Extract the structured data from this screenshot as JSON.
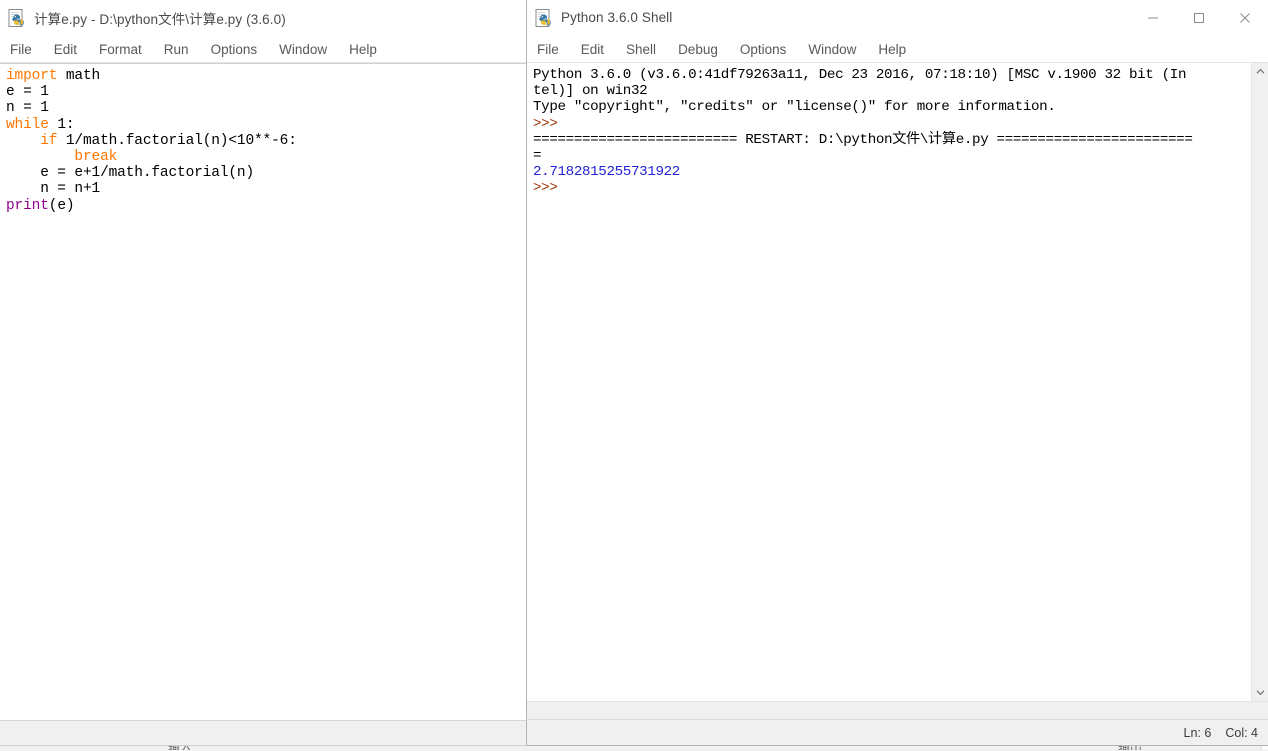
{
  "editor_window": {
    "icon": "python-idle-icon",
    "title": "计算e.py - D:\\python文件\\计算e.py (3.6.0)",
    "menus": [
      "File",
      "Edit",
      "Format",
      "Run",
      "Options",
      "Window",
      "Help"
    ],
    "code_lines": [
      [
        {
          "t": "import",
          "c": "kw"
        },
        {
          "t": " math",
          "c": ""
        }
      ],
      [
        {
          "t": "e = 1",
          "c": ""
        }
      ],
      [
        {
          "t": "n = 1",
          "c": ""
        }
      ],
      [
        {
          "t": "while",
          "c": "kw"
        },
        {
          "t": " 1:",
          "c": ""
        }
      ],
      [
        {
          "t": "    ",
          "c": ""
        },
        {
          "t": "if",
          "c": "kw"
        },
        {
          "t": " 1/math.factorial(n)<10**-6:",
          "c": ""
        }
      ],
      [
        {
          "t": "        ",
          "c": ""
        },
        {
          "t": "break",
          "c": "kw"
        }
      ],
      [
        {
          "t": "    e = e+1/math.factorial(n)",
          "c": ""
        }
      ],
      [
        {
          "t": "    n = n+1",
          "c": ""
        }
      ],
      [
        {
          "t": "print",
          "c": "bi"
        },
        {
          "t": "(e)",
          "c": ""
        }
      ]
    ]
  },
  "shell_window": {
    "icon": "python-idle-icon",
    "title": "Python 3.6.0 Shell",
    "menus": [
      "File",
      "Edit",
      "Shell",
      "Debug",
      "Options",
      "Window",
      "Help"
    ],
    "window_buttons": {
      "minimize": "minimize-icon",
      "maximize": "maximize-icon",
      "close": "close-icon"
    },
    "output_lines": [
      [
        {
          "t": "Python 3.6.0 (v3.6.0:41df79263a11, Dec 23 2016, 07:18:10) [MSC v.1900 32 bit (In",
          "c": ""
        }
      ],
      [
        {
          "t": "tel)] on win32",
          "c": ""
        }
      ],
      [
        {
          "t": "Type \"copyright\", \"credits\" or \"license()\" for more information.",
          "c": ""
        }
      ],
      [
        {
          "t": ">>> ",
          "c": "prompt"
        }
      ],
      [
        {
          "t": "========================= RESTART: D:\\python文件\\计算e.py ========================",
          "c": ""
        }
      ],
      [
        {
          "t": "=",
          "c": ""
        }
      ],
      [
        {
          "t": "2.7182815255731922",
          "c": "stdout"
        }
      ],
      [
        {
          "t": ">>> ",
          "c": "prompt"
        }
      ]
    ],
    "statusbar": {
      "line_label": "Ln: 6",
      "col_label": "Col: 4"
    },
    "scrollbar": {
      "up_arrow": "chevron-up-icon",
      "down_arrow": "chevron-down-icon"
    }
  },
  "background": {
    "fragment_left": "输入",
    "fragment_right": "输出",
    "edge_marks": [
      "l",
      "n"
    ]
  },
  "colors": {
    "keyword": "#ff7700",
    "builtin": "#900090",
    "prompt": "#993300",
    "stdout": "#2121d6",
    "window_bg": "#ffffff",
    "chrome_bg": "#f0f0f0"
  }
}
